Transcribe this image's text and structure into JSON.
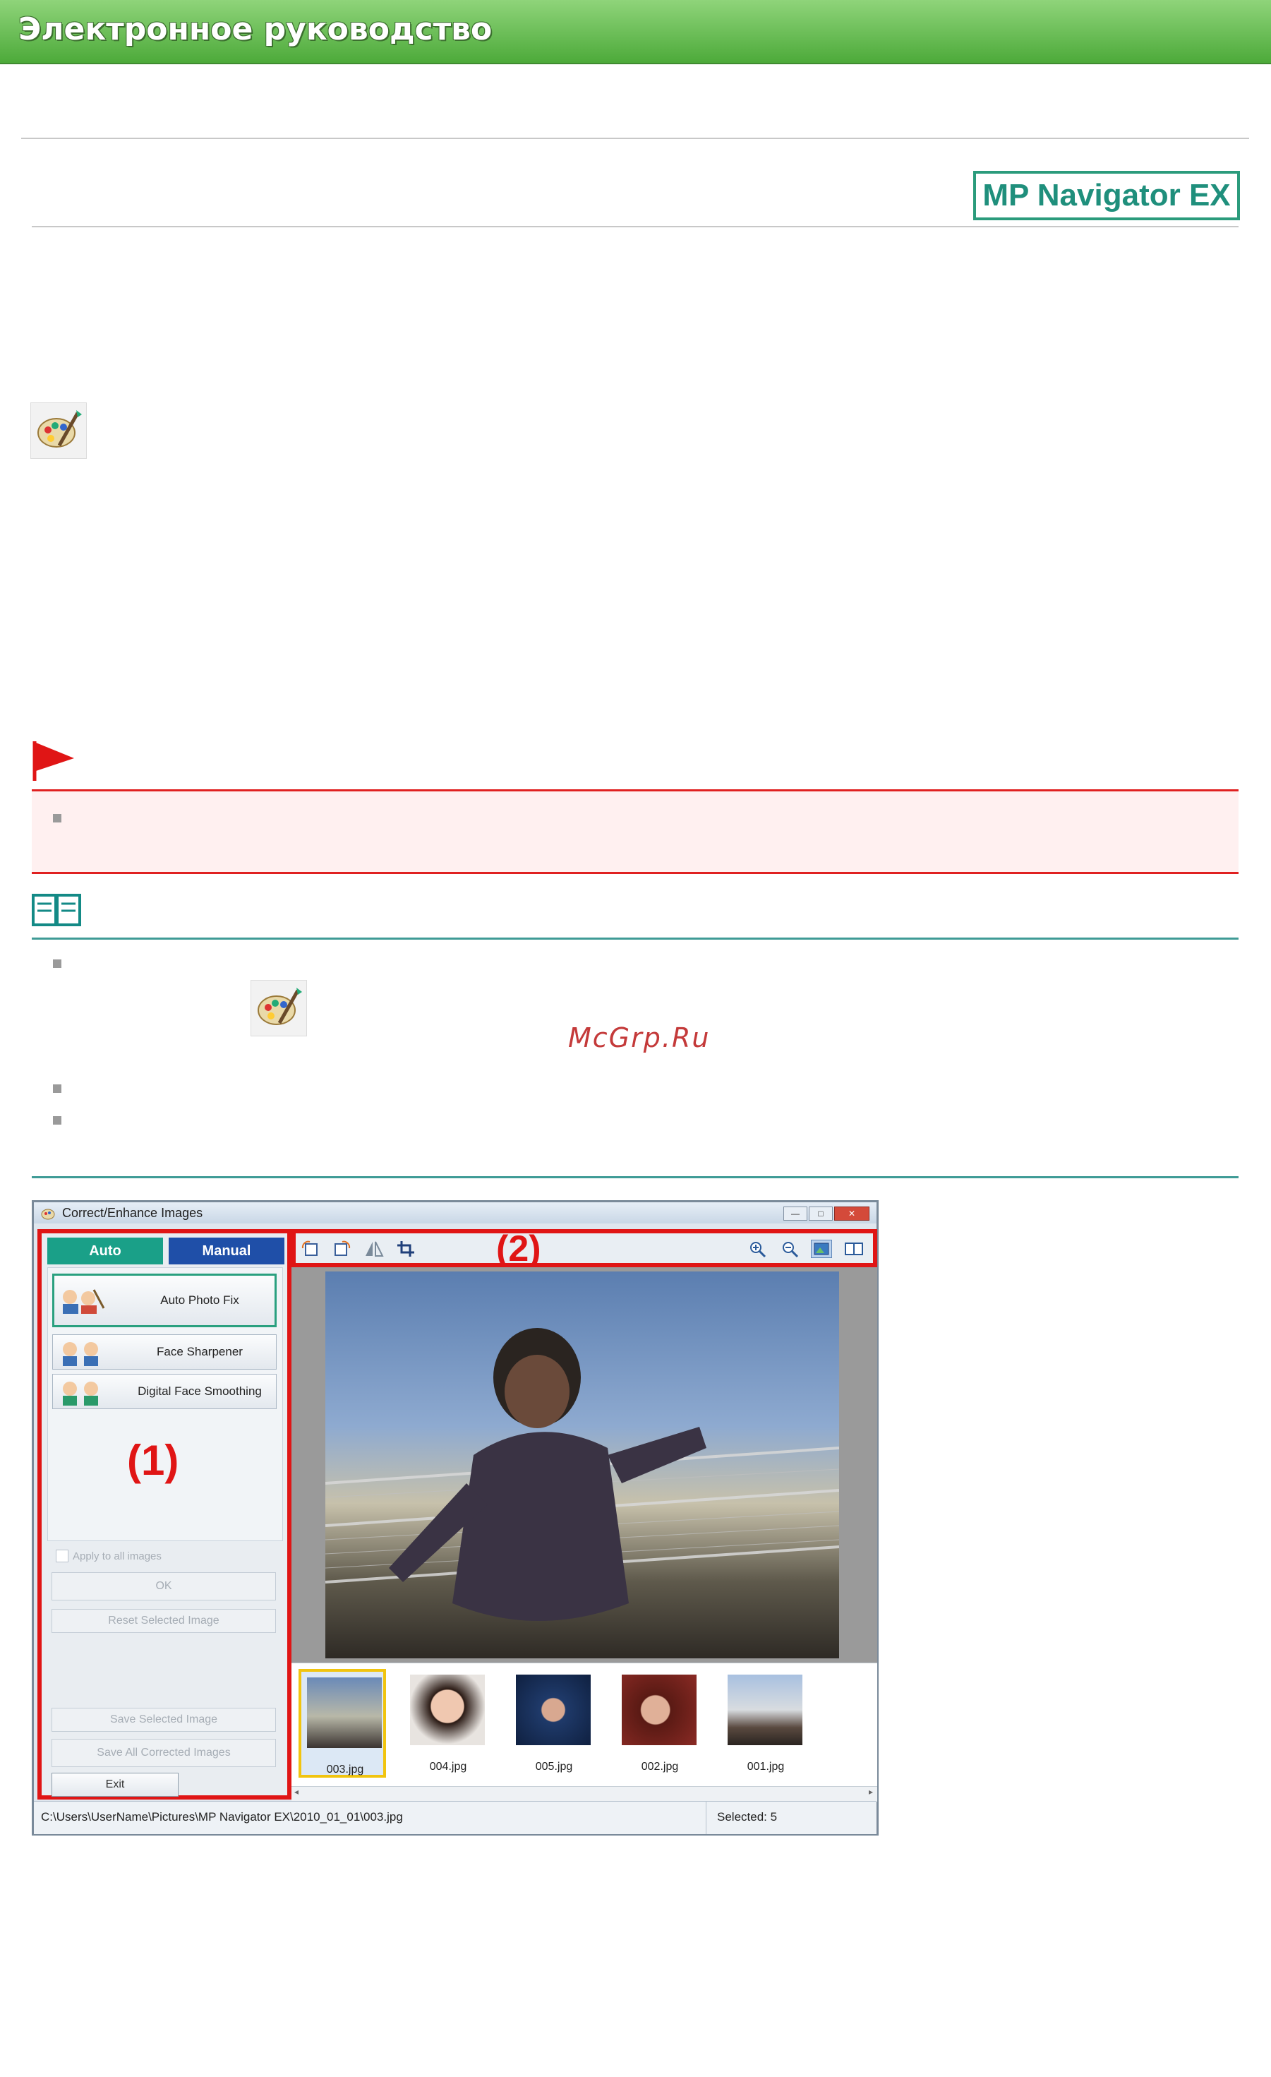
{
  "header": {
    "title": "Электронное руководство"
  },
  "product_badge": "MP Navigator EX",
  "watermark": "McGrp.Ru",
  "window": {
    "title": "Correct/Enhance Images",
    "tabs": [
      {
        "label": "Auto"
      },
      {
        "label": "Manual"
      }
    ],
    "auto_buttons": [
      {
        "label": "Auto Photo Fix"
      },
      {
        "label": "Face Sharpener"
      },
      {
        "label": "Digital Face Smoothing"
      }
    ],
    "panel_marker": "(1)",
    "toolbar_marker": "(2)",
    "apply_all_label": "Apply to all images",
    "ok_label": "OK",
    "reset_label": "Reset Selected Image",
    "save_selected_label": "Save Selected Image",
    "save_all_label": "Save All Corrected Images",
    "exit_label": "Exit",
    "thumbnails": [
      {
        "name": "003.jpg",
        "selected": true
      },
      {
        "name": "004.jpg",
        "selected": false
      },
      {
        "name": "005.jpg",
        "selected": false
      },
      {
        "name": "002.jpg",
        "selected": false
      },
      {
        "name": "001.jpg",
        "selected": false
      }
    ],
    "status_path": "C:\\Users\\UserName\\Pictures\\MP Navigator EX\\2010_01_01\\003.jpg",
    "status_selected": "Selected: 5"
  },
  "colors": {
    "header_green": "#4daa3a",
    "marker_red": "#e01515",
    "teal": "#2b9b7c"
  }
}
